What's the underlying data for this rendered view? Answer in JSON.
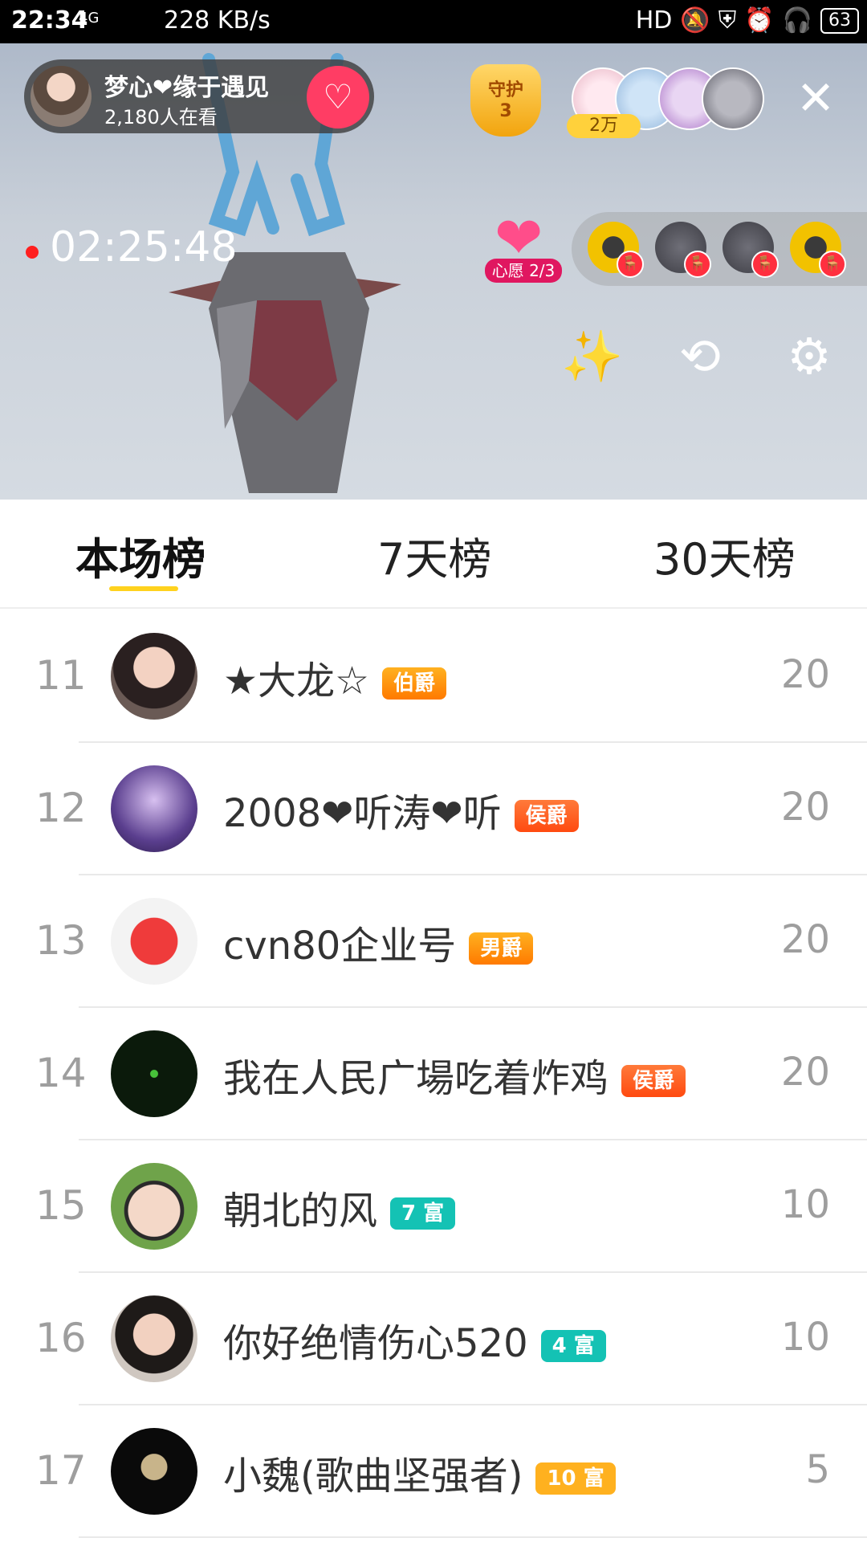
{
  "status_bar": {
    "time": "22:34",
    "network": "4G",
    "speed": "228 KB/s",
    "hd": "HD",
    "battery": "63"
  },
  "host": {
    "name": "梦心❤缘于遇见",
    "viewers": "2,180人在看"
  },
  "guard": {
    "title": "守护",
    "count": "3"
  },
  "fans": {
    "badge": "2万"
  },
  "live_timer": "02:25:48",
  "wish": {
    "label": "心愿 2/3"
  },
  "tabs": [
    {
      "label": "本场榜"
    },
    {
      "label": "7天榜"
    },
    {
      "label": "30天榜"
    }
  ],
  "rows": [
    {
      "rank": "11",
      "name": "★大龙☆",
      "badge": "伯爵",
      "score": "20"
    },
    {
      "rank": "12",
      "name": "2008❤听涛❤听",
      "badge": "侯爵",
      "score": "20"
    },
    {
      "rank": "13",
      "name": "cvn80企业号",
      "badge": "男爵",
      "score": "20"
    },
    {
      "rank": "14",
      "name": "我在人民广場吃着炸鸡",
      "badge": "侯爵",
      "score": "20"
    },
    {
      "rank": "15",
      "name": "朝北的风",
      "badge": "7 富",
      "score": "10"
    },
    {
      "rank": "16",
      "name": "你好绝情伤心520",
      "badge": "4 富",
      "score": "10"
    },
    {
      "rank": "17",
      "name": "小魏(歌曲坚强者)",
      "badge": "10 富",
      "score": "5"
    }
  ],
  "icons": {
    "close": "close-icon",
    "beauty": "magic-wand-icon",
    "camera_flip": "camera-switch-icon",
    "settings": "gear-icon",
    "follow": "heart-plus-icon"
  },
  "colors": {
    "accent": "#ffd21e",
    "pink": "#ff3d64",
    "teal": "#14c2b4",
    "orange": "#ff7a00"
  }
}
